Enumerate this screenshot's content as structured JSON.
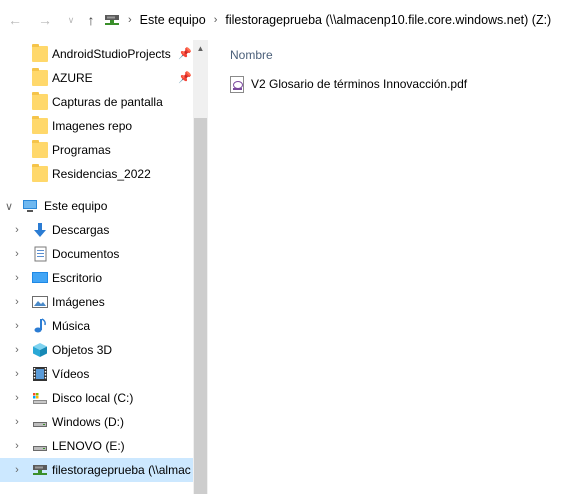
{
  "toolbar": {
    "back_icon": "arrow-left-icon",
    "forward_icon": "arrow-right-icon",
    "recent_icon": "chevron-down-icon",
    "up_icon": "arrow-up-icon"
  },
  "breadcrumb": {
    "segments": [
      "Este equipo",
      "filestorageprueba (\\\\almacenp10.file.core.windows.net) (Z:)"
    ]
  },
  "sidebar": {
    "quick_access": [
      {
        "label": "AndroidStudioProjects",
        "pinned": true
      },
      {
        "label": "AZURE",
        "pinned": true
      },
      {
        "label": "Capturas de pantalla",
        "pinned": false
      },
      {
        "label": "Imagenes repo",
        "pinned": false
      },
      {
        "label": "Programas",
        "pinned": false
      },
      {
        "label": "Residencias_2022",
        "pinned": false
      }
    ],
    "this_pc_label": "Este equipo",
    "this_pc_items": [
      {
        "label": "Descargas",
        "icon": "download-icon"
      },
      {
        "label": "Documentos",
        "icon": "documents-icon"
      },
      {
        "label": "Escritorio",
        "icon": "desktop-icon"
      },
      {
        "label": "Imágenes",
        "icon": "pictures-icon"
      },
      {
        "label": "Música",
        "icon": "music-icon"
      },
      {
        "label": "Objetos 3D",
        "icon": "3d-objects-icon"
      },
      {
        "label": "Vídeos",
        "icon": "videos-icon"
      },
      {
        "label": "Disco local (C:)",
        "icon": "local-disk-icon"
      },
      {
        "label": "Windows (D:)",
        "icon": "drive-icon"
      },
      {
        "label": "LENOVO (E:)",
        "icon": "drive-icon"
      },
      {
        "label": "filestorageprueba (\\\\almac",
        "icon": "network-drive-icon",
        "selected": true
      }
    ]
  },
  "main": {
    "column_header": "Nombre",
    "files": [
      {
        "name": "V2 Glosario de términos Innovacción.pdf",
        "icon": "pdf-icon"
      }
    ]
  },
  "colors": {
    "selected_bg": "#cce8ff",
    "folder": "#ffd86b",
    "header_text": "#4c607a"
  }
}
